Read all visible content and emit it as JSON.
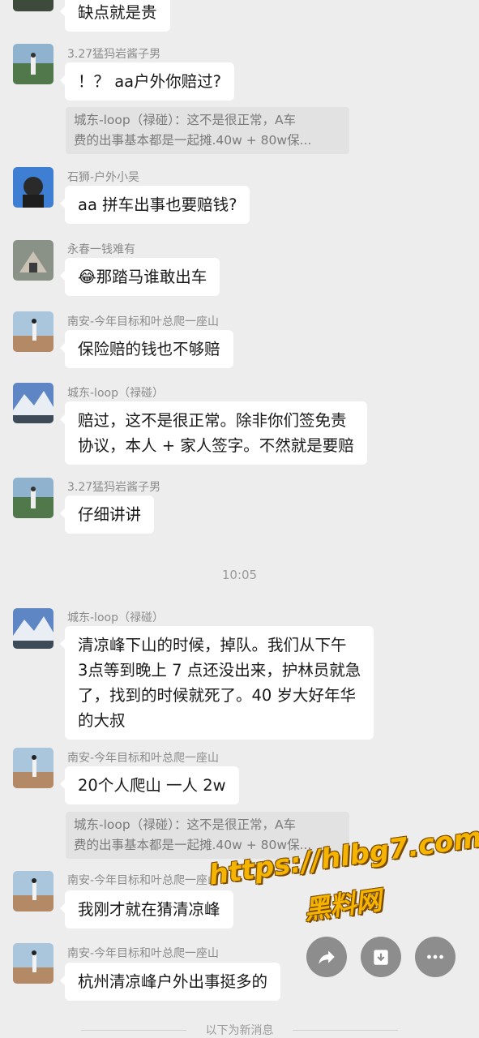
{
  "messages": {
    "m0": {
      "text": "缺点就是贵"
    },
    "m1": {
      "name": "3.27猛犸岩酱子男",
      "text": "！？ aa户外你赔过?",
      "quote_line1": "城东-loop（禄碰）：这不是很正常，A车",
      "quote_line2": "费的出事基本都是一起摊.40w + 80w保..."
    },
    "m2": {
      "name": "石狮-户外小吴",
      "text": "aa 拼车出事也要赔钱?"
    },
    "m3": {
      "name": "永春一钱难有",
      "emoji": "😂",
      "text": "那踏马谁敢出车"
    },
    "m4": {
      "name": "南安-今年目标和叶总爬一座山",
      "text": "保险赔的钱也不够赔"
    },
    "m5": {
      "name": "城东-loop（禄碰）",
      "line1": "赔过，这不是很正常。除非你们签免责",
      "line2": "协议，本人 + 家人签字。不然就是要赔"
    },
    "m6": {
      "name": "3.27猛犸岩酱子男",
      "text": "仔细讲讲"
    },
    "time": "10:05",
    "m7": {
      "name": "城东-loop（禄碰）",
      "line1": "清凉峰下山的时候，掉队。我们从下午",
      "line2": "3点等到晚上 7 点还没出来，护林员就急",
      "line3": "了，找到的时候就死了。40 岁大好年华",
      "line4": "的大叔"
    },
    "m8": {
      "name": "南安-今年目标和叶总爬一座山",
      "text": "20个人爬山 一人 2w",
      "quote_line1": "城东-loop（禄碰）：这不是很正常，A车",
      "quote_line2": "费的出事基本都是一起摊.40w + 80w保..."
    },
    "m9": {
      "name": "南安-今年目标和叶总爬一座山",
      "text": "我刚才就在猜清凉峰"
    },
    "m10": {
      "name": "南安-今年目标和叶总爬一座山",
      "text": "杭州清凉峰户外出事挺多的"
    },
    "divider": "以下为新消息"
  },
  "watermark": {
    "url": "https://hlbg7.com",
    "label": "黑料网"
  },
  "actions": {
    "share_icon": "share-icon",
    "save_icon": "download-icon",
    "more_icon": "more-icon"
  }
}
